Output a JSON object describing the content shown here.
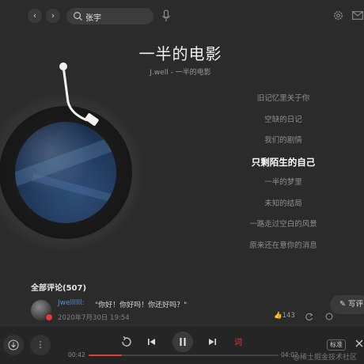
{
  "topbar": {
    "back_glyph": "‹",
    "forward_glyph": "›",
    "search_value": "张宇"
  },
  "song": {
    "title": "一半的电影",
    "subtitle": "J.well - 一半的电影"
  },
  "lyrics": [
    {
      "text": "旧记忆里关于你",
      "active": false
    },
    {
      "text": "空缺的日记",
      "active": false
    },
    {
      "text": "我们的剧情",
      "active": false
    },
    {
      "text": "只剩陌生的自己",
      "active": true
    },
    {
      "text": "一半的梦里",
      "active": false
    },
    {
      "text": "未知的结局",
      "active": false
    },
    {
      "text": "一路走过空白的风景",
      "active": false
    },
    {
      "text": "原来还在意你的消息",
      "active": false
    }
  ],
  "comments": {
    "title": "全部评论(507)",
    "write_label": "写评",
    "items": [
      {
        "user": "Jwellllll:",
        "text": "\"你好！你好吗！你还好吗？\"",
        "date": "2020年7月30日 19:54",
        "likes": "143"
      }
    ]
  },
  "player": {
    "current_time": "00:42",
    "total_time": "04:02",
    "progress_fraction": 0.174,
    "quality_label": "标准",
    "accent_color": "#e23c3c"
  },
  "watermark": "@稀土掘金技术社区"
}
